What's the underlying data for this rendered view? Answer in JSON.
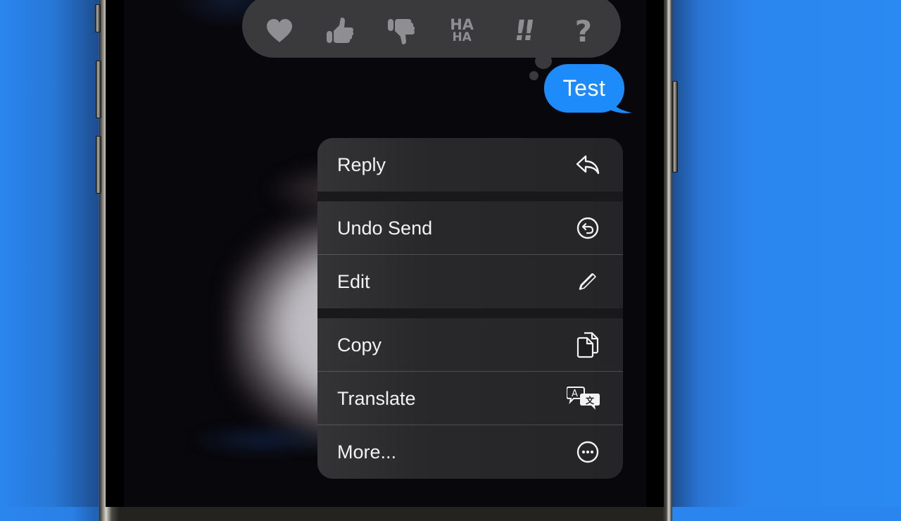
{
  "reactions": [
    {
      "name": "heart",
      "label": "Love"
    },
    {
      "name": "thumbs-up",
      "label": "Like"
    },
    {
      "name": "thumbs-down",
      "label": "Dislike"
    },
    {
      "name": "haha",
      "label": "HA HA",
      "line1": "HA",
      "line2": "HA"
    },
    {
      "name": "exclamation",
      "label": "!!"
    },
    {
      "name": "question",
      "label": "?"
    }
  ],
  "message": {
    "text": "Test",
    "bubble_color": "#1e8bfa"
  },
  "menu": {
    "items": [
      {
        "label": "Reply",
        "icon": "reply-arrow-icon"
      },
      {
        "label": "Undo Send",
        "icon": "undo-circle-icon"
      },
      {
        "label": "Edit",
        "icon": "pencil-icon"
      },
      {
        "label": "Copy",
        "icon": "copy-documents-icon"
      },
      {
        "label": "Translate",
        "icon": "translate-bubbles-icon"
      },
      {
        "label": "More...",
        "icon": "ellipsis-circle-icon"
      }
    ]
  },
  "colors": {
    "background_blue": "#2a86ee",
    "reaction_bar": "#3a3a3c",
    "reaction_glyph": "#8e8e93",
    "menu_bg": "#1d1d20",
    "menu_text": "#f2f2f4"
  }
}
